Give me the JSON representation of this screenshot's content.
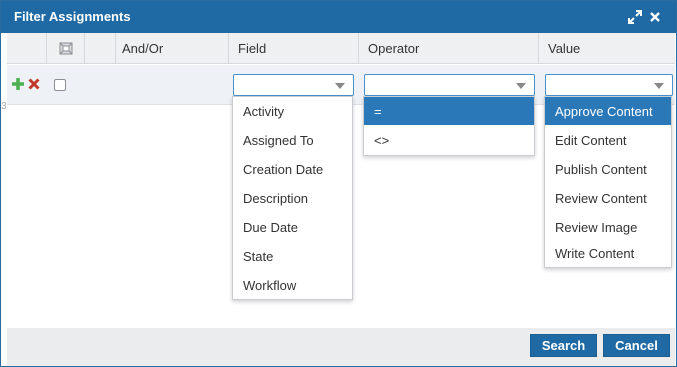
{
  "dialog": {
    "title": "Filter Assignments"
  },
  "table": {
    "headers": {
      "andor": "And/Or",
      "field": "Field",
      "operator": "Operator",
      "value": "Value"
    }
  },
  "row_marker": "3",
  "field_dropdown": {
    "options": [
      "Activity",
      "Assigned To",
      "Creation Date",
      "Description",
      "Due Date",
      "State",
      "Workflow"
    ]
  },
  "operator_dropdown": {
    "options": [
      "=",
      "<>"
    ],
    "selected": "="
  },
  "value_dropdown": {
    "options": [
      "Approve Content",
      "Edit Content",
      "Publish Content",
      "Review Content",
      "Review Image",
      "Write Content"
    ],
    "selected": "Approve Content"
  },
  "footer": {
    "search_label": "Search",
    "cancel_label": "Cancel"
  },
  "colors": {
    "titlebar": "#1f6aa5",
    "selection": "#2b78b9",
    "add_icon": "#4caf50",
    "delete_icon": "#c0392b"
  },
  "icons": {
    "expand": "expand-icon",
    "close": "close-icon",
    "select_all": "select-all-icon",
    "add": "add-row-icon",
    "delete": "delete-row-icon"
  }
}
